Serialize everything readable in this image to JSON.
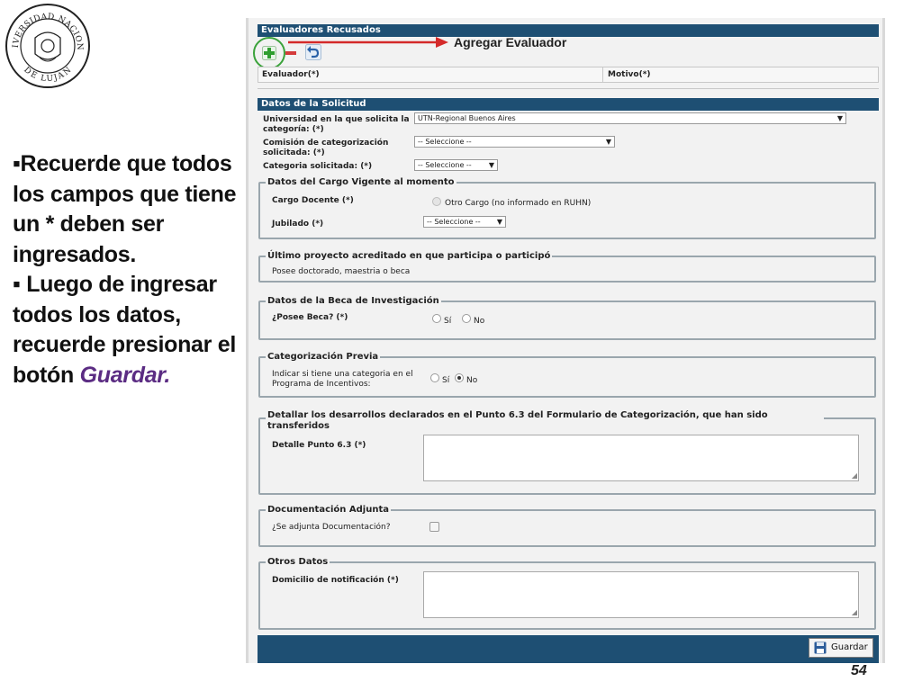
{
  "logo": {
    "text_top": "UNIVERSIDAD NACIONAL",
    "text_bottom": "DE LUJAN"
  },
  "notes": {
    "item1": "▪Recuerde que todos los campos que tiene un * deben ser ingresados.",
    "item2_prefix": "▪ Luego de ingresar todos los datos, recuerde presionar el botón",
    "item2_emphasis": "Guardar."
  },
  "page_number": "54",
  "form": {
    "evaluadores": {
      "title": "Evaluadores Recusados",
      "annotation": "Agregar Evaluador",
      "columns": [
        "Evaluador(*)",
        "Motivo(*)"
      ]
    },
    "solicitud": {
      "title": "Datos de la Solicitud",
      "universidad_label": "Universidad en la que solicita la categoría: (*)",
      "universidad_value": "UTN-Regional Buenos Aires",
      "comision_label": "Comisión de categorización solicitada: (*)",
      "comision_value": "-- Seleccione --",
      "categoria_label": "Categoria solicitada: (*)",
      "categoria_value": "-- Seleccione --"
    },
    "cargo": {
      "legend": "Datos del Cargo Vigente al momento",
      "cargo_label": "Cargo Docente (*)",
      "otro_cargo": "Otro Cargo (no informado en RUHN)",
      "jubilado_label": "Jubilado (*)",
      "jubilado_value": "-- Seleccione --"
    },
    "proyecto": {
      "legend": "Último proyecto acreditado en que participa o participó",
      "text": "Posee doctorado, maestria o beca"
    },
    "beca": {
      "legend": "Datos de la Beca de Investigación",
      "label": "¿Posee Beca? (*)",
      "si": "Sí",
      "no": "No"
    },
    "previa": {
      "legend": "Categorización Previa",
      "label": "Indicar si tiene una categoria en el Programa de Incentivos:",
      "si": "Sí",
      "no": "No"
    },
    "desarrollos": {
      "legend": "Detallar los desarrollos declarados en el Punto 6.3 del Formulario de Categorización, que han sido transferidos",
      "label": "Detalle Punto 6.3 (*)"
    },
    "documentacion": {
      "legend": "Documentación Adjunta",
      "label": "¿Se adjunta Documentación?"
    },
    "otros": {
      "legend": "Otros Datos",
      "label": "Domicilio de notificación (*)"
    },
    "save_label": "Guardar"
  },
  "colors": {
    "header_bar": "#1e4f73",
    "highlight_circle": "#3aa23a",
    "arrow": "#d42a2a",
    "emphasis_text": "#5b2c83"
  }
}
